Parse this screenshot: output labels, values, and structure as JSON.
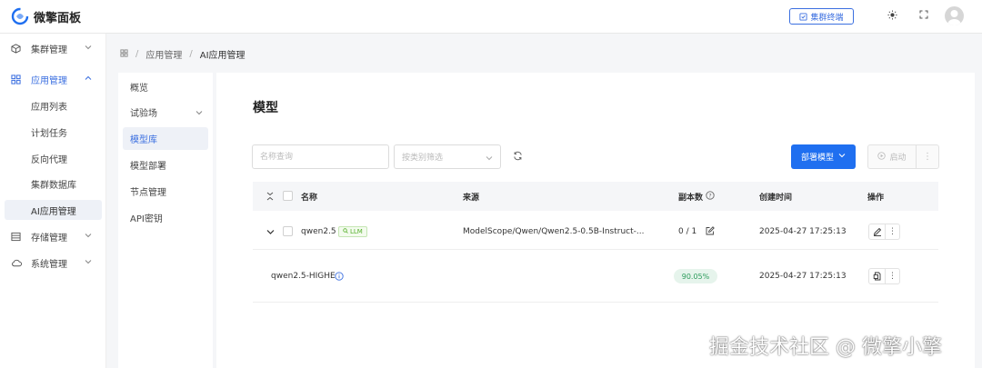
{
  "header": {
    "app_title": "微擎面板",
    "cluster_terminal_label": "集群终端"
  },
  "sidebar": {
    "groups": [
      {
        "label": "集群管理"
      },
      {
        "label": "应用管理",
        "items": [
          "应用列表",
          "计划任务",
          "反向代理",
          "集群数据库",
          "AI应用管理"
        ]
      },
      {
        "label": "存储管理"
      },
      {
        "label": "系统管理"
      }
    ]
  },
  "breadcrumb": {
    "sep": "/",
    "items": [
      "应用管理",
      "AI应用管理"
    ]
  },
  "subnav": {
    "items": [
      "概览",
      "试验场",
      "模型库",
      "模型部署",
      "节点管理",
      "API密钥"
    ]
  },
  "main": {
    "title": "模型",
    "search_placeholder": "名称查询",
    "category_placeholder": "按类别筛选",
    "deploy_label": "部署模型",
    "start_label": "启动",
    "more_label": "⋮",
    "table": {
      "headers": [
        "名称",
        "来源",
        "副本数",
        "创建时间",
        "操作"
      ],
      "rows": [
        {
          "name": "qwen2.5",
          "tag": "LLM",
          "source": "ModelScope/Qwen/Qwen2.5-0.5B-Instruct-...",
          "replicas": "0 / 1",
          "created": "2025-04-27 17:25:13"
        },
        {
          "name": "qwen2.5-HIGHE",
          "progress": "90.05%",
          "progress_value": 0.9005,
          "created": "2025-04-27 17:25:13"
        }
      ]
    }
  },
  "watermark": "掘金技术社区 @ 微擎小擎",
  "colors": {
    "accent": "#3b6fe0",
    "primary_button": "#1f6ff0",
    "tag_green": "#58b12e",
    "progress_green": "#2d9c5c"
  }
}
